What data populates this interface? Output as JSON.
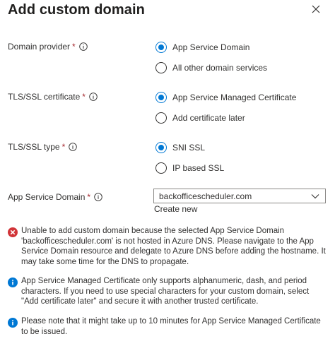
{
  "header": {
    "title": "Add custom domain",
    "close_icon": "close-icon"
  },
  "form": {
    "domain_provider": {
      "label": "Domain provider",
      "required_mark": "*",
      "options": [
        "App Service Domain",
        "All other domain services"
      ],
      "selected": "App Service Domain"
    },
    "tls_certificate": {
      "label": "TLS/SSL certificate",
      "required_mark": "*",
      "options": [
        "App Service Managed Certificate",
        "Add certificate later"
      ],
      "selected": "App Service Managed Certificate"
    },
    "tls_type": {
      "label": "TLS/SSL type",
      "required_mark": "*",
      "options": [
        "SNI SSL",
        "IP based SSL"
      ],
      "selected": "SNI SSL"
    },
    "app_service_domain": {
      "label": "App Service Domain",
      "required_mark": "*",
      "value": "backofficescheduler.com",
      "create_new": "Create new"
    }
  },
  "messages": [
    {
      "kind": "error",
      "text": "Unable to add custom domain because the selected App Service Domain 'backofficescheduler.com' is not hosted in Azure DNS. Please navigate to the App Service Domain resource and delegate to Azure DNS before adding the hostname. It may take some time for the DNS to propagate."
    },
    {
      "kind": "info",
      "text": "App Service Managed Certificate only supports alphanumeric, dash, and period characters. If you need to use special characters for your custom domain, select \"Add certificate later\" and secure it with another trusted certificate."
    },
    {
      "kind": "info",
      "text": "Please note that it might take up to 10 minutes for App Service Managed Certificate to be issued."
    }
  ],
  "colors": {
    "accent": "#0078d4",
    "error": "#d13438",
    "required": "#a4262c"
  }
}
